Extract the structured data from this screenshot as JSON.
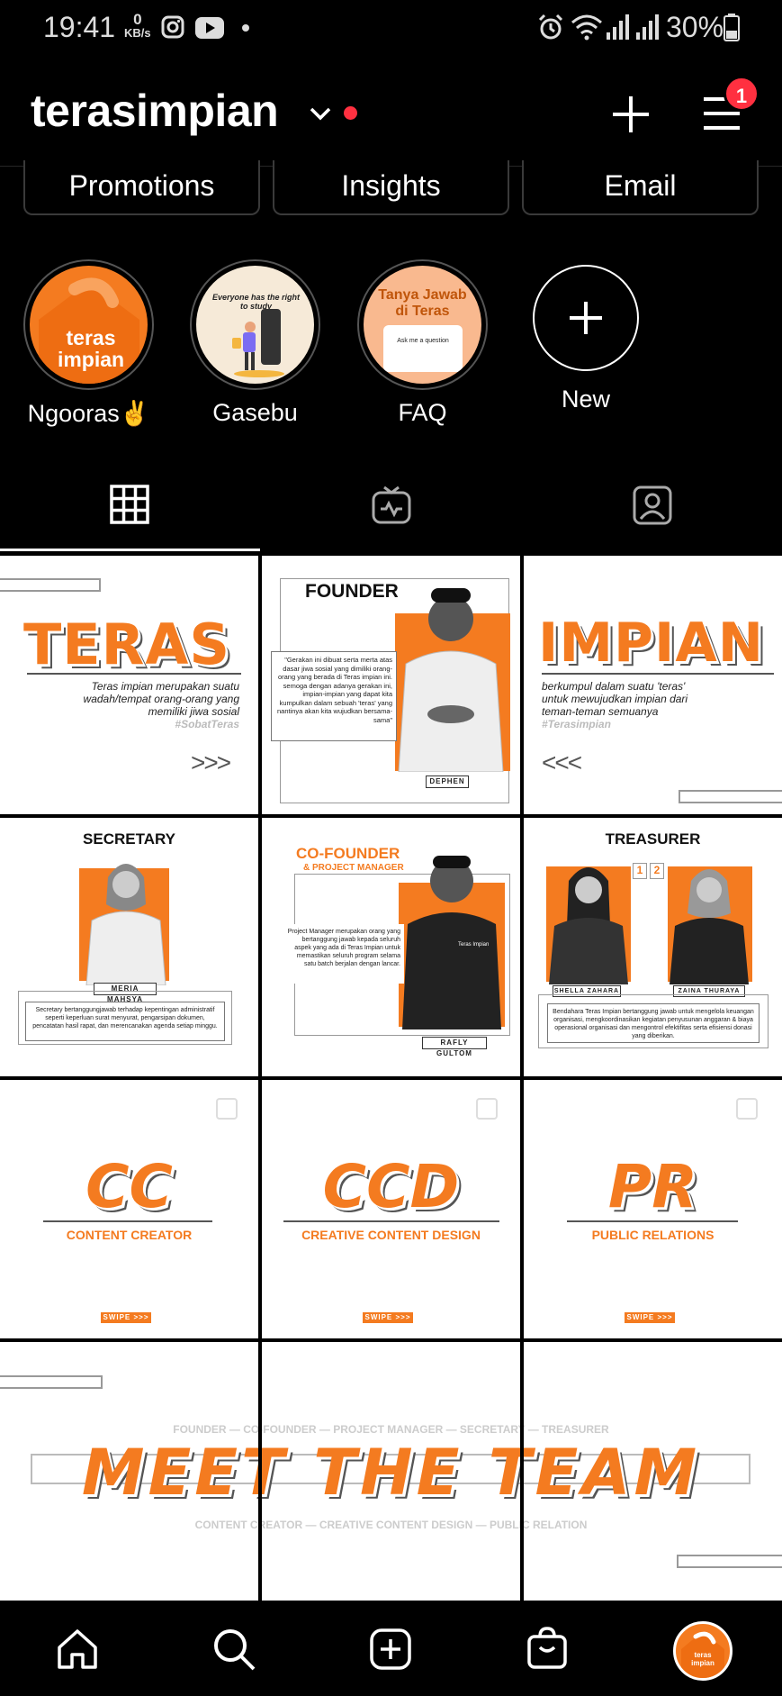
{
  "status": {
    "time": "19:41",
    "speed_value": "0",
    "speed_unit": "KB/s",
    "battery": "30%"
  },
  "header": {
    "username": "terasimpian",
    "notif_count": "1"
  },
  "profile_buttons": [
    "Promotions",
    "Insights",
    "Email"
  ],
  "highlights": [
    {
      "label": "Ngooras✌",
      "cover_text": "teras impian"
    },
    {
      "label": "Gasebu",
      "cover_text": "Everyone has the right to study"
    },
    {
      "label": "FAQ",
      "cover_text": "Tanya Jawab di Teras",
      "cover_sub": "Ask me a question"
    },
    {
      "label": "New"
    }
  ],
  "posts": {
    "teras": {
      "title": "TERAS",
      "desc": "Teras impian merupakan suatu wadah/tempat orang-orang yang memiliki jiwa sosial",
      "tag": "#SobatTeras",
      "arrows": ">>>"
    },
    "founder": {
      "title": "FOUNDER",
      "quote": "\"Gerakan ini dibuat serta merta atas dasar jiwa sosial yang dimiliki orang-orang yang berada di Teras impian ini. semoga dengan adanya gerakan ini, impian-impian yang dapat kita kumpulkan dalam sebuah 'teras' yang nantinya akan kita wujudkan bersama-sama\"",
      "name": "DEPHEN"
    },
    "impian": {
      "title": "IMPIAN",
      "desc": "berkumpul dalam suatu 'teras' untuk mewujudkan impian dari teman-teman semuanya",
      "tag": "#Terasimpian",
      "arrows": "<<<"
    },
    "secretary": {
      "title": "SECRETARY",
      "name": "MERIA MAHSYA",
      "desc": "Secretary bertanggungjawab terhadap kepentingan administratif seperti keperluan surat menyurat, pengarsipan dokumen, pencatatan hasil rapat, dan merencanakan agenda setiap minggu."
    },
    "cofounder": {
      "title": "CO-FOUNDER",
      "subtitle": "& PROJECT MANAGER",
      "desc": "Project Manager merupakan orang yang bertanggung jawab kepada seluruh aspek yang ada di Teras Impian untuk memastikan seluruh program selama satu batch berjalan dengan lancar.",
      "name": "RAFLY GULTOM"
    },
    "treasurer": {
      "title": "TREASURER",
      "num1": "1",
      "num2": "2",
      "name1": "SHELLA ZAHARA",
      "name2": "ZAINA THURAYA",
      "desc": "Bendahara Teras Impian bertanggung jawab untuk mengelola keuangan organisasi, mengkoordinasikan kegiatan penyusunan anggaran & biaya operasional organisasi dan mengontrol efektifitas serta efisiensi donasi yang diberikan."
    },
    "cc": {
      "title": "CC",
      "subtitle": "CONTENT CREATOR",
      "swipe": "SWIPE >>>"
    },
    "ccd": {
      "title": "CCD",
      "subtitle": "CREATIVE CONTENT DESIGN",
      "swipe": "SWIPE >>>"
    },
    "pr": {
      "title": "PR",
      "subtitle": "PUBLIC RELATIONS",
      "swipe": "SWIPE >>>"
    },
    "team": {
      "top": "FOUNDER — CO-FOUNDER — PROJECT MANAGER — SECRETARY — TREASURER",
      "title": "MEET THE TEAM",
      "bottom": "CONTENT CREATOR — CREATIVE CONTENT DESIGN — PUBLIC RELATION"
    }
  },
  "nav": {
    "avatar_text": "teras impian"
  },
  "colors": {
    "accent": "#f47b20",
    "notif": "#ff3040"
  }
}
